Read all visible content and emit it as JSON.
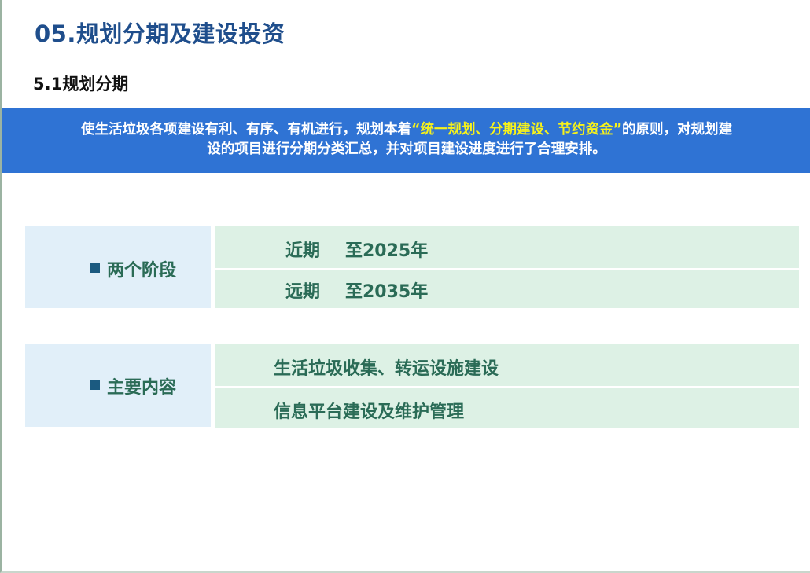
{
  "header": {
    "title": "05.规划分期及建设投资",
    "subtitle": "5.1规划分期"
  },
  "banner": {
    "text_before": "使生活垃圾各项建设有利、有序、有机进行，规划本着",
    "highlight": "“统一规划、分期建设、节约资金”",
    "text_after_line1": "的原则，对规划建",
    "text_line2": "设的项目进行分期分类汇总，并对项目建设进度进行了合理安排。",
    "highlight_color": "#f7f21a",
    "background_color": "#2f73d4"
  },
  "phases": {
    "label": "两个阶段",
    "items": [
      {
        "name": "近期",
        "target": "至2025年"
      },
      {
        "name": "远期",
        "target": "至2035年"
      }
    ]
  },
  "contents": {
    "label": "主要内容",
    "items": [
      {
        "text": "生活垃圾收集、转运设施建设"
      },
      {
        "text": "信息平台建设及维护管理"
      }
    ]
  }
}
